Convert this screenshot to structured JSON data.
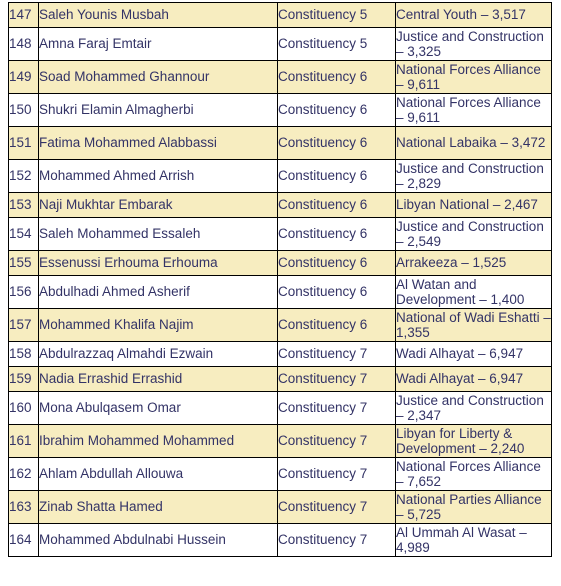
{
  "table": {
    "columns": [
      "index",
      "candidate_name",
      "constituency",
      "party_and_votes"
    ],
    "colors": {
      "shaded_row": "#f7edc0",
      "plain_row": "#ffffff",
      "text": "#333366",
      "border": "#000000"
    },
    "rows": [
      {
        "index": "147",
        "name": "Saleh Younis  Musbah",
        "constituency": "Constituency 5",
        "party": "Central Youth – 3,517",
        "shaded": true,
        "lines": 1
      },
      {
        "index": "148",
        "name": "Amna Faraj Emtair",
        "constituency": "Constituency 5",
        "party": "Justice and Construction – 3,325",
        "shaded": false,
        "lines": 2
      },
      {
        "index": "149",
        "name": "Soad Mohammed Ghannour",
        "constituency": "Constituency 6",
        "party": "National Forces Alliance – 9,611",
        "shaded": true,
        "lines": 2
      },
      {
        "index": "150",
        "name": "Shukri Elamin Almagherbi",
        "constituency": "Constituency 6",
        "party": "National Forces Alliance – 9,611",
        "shaded": false,
        "lines": 2
      },
      {
        "index": "151",
        "name": "Fatima Mohammed Alabbassi",
        "constituency": "Constituency 6",
        "party": "National Labaika – 3,472",
        "shaded": true,
        "lines": 2
      },
      {
        "index": "152",
        "name": "Mohammed Ahmed Arrish",
        "constituency": "Constituency 6",
        "party": "Justice and Construction – 2,829",
        "shaded": false,
        "lines": 2
      },
      {
        "index": "153",
        "name": "Naji Mukhtar Embarak",
        "constituency": "Constituency 6",
        "party": "Libyan National – 2,467",
        "shaded": true,
        "lines": 1
      },
      {
        "index": "154",
        "name": "Saleh Mohammed Essaleh",
        "constituency": "Constituency 6",
        "party": "Justice and Construction – 2,549",
        "shaded": false,
        "lines": 2
      },
      {
        "index": "155",
        "name": "Essenussi Erhouma Erhouma",
        "constituency": "Constituency 6",
        "party": "Arrakeeza – 1,525",
        "shaded": true,
        "lines": 1
      },
      {
        "index": "156",
        "name": "Abdulhadi Ahmed Asherif",
        "constituency": "Constituency 6",
        "party": "Al Watan and Development – 1,400",
        "shaded": false,
        "lines": 2
      },
      {
        "index": "157",
        "name": "Mohammed Khalifa Najim",
        "constituency": "Constituency 6",
        "party": "National of Wadi Eshatti – 1,355",
        "shaded": true,
        "lines": 2
      },
      {
        "index": "158",
        "name": "Abdulrazzaq Almahdi Ezwain",
        "constituency": "Constituency 7",
        "party": "Wadi Alhayat – 6,947",
        "shaded": false,
        "lines": 1
      },
      {
        "index": "159",
        "name": "Nadia Errashid Errashid",
        "constituency": "Constituency 7",
        "party": "Wadi Alhayat – 6,947",
        "shaded": true,
        "lines": 1
      },
      {
        "index": "160",
        "name": "Mona Abulqasem Omar",
        "constituency": "Constituency 7",
        "party": "Justice and Construction – 2,347",
        "shaded": false,
        "lines": 2
      },
      {
        "index": "161",
        "name": "Ibrahim Mohammed Mohammed",
        "constituency": "Constituency 7",
        "party": "Libyan for Liberty & Development – 2,240",
        "shaded": true,
        "lines": 2
      },
      {
        "index": "162",
        "name": "Ahlam Abdullah Allouwa",
        "constituency": "Constituency 7",
        "party": "National Forces Alliance – 7,652",
        "shaded": false,
        "lines": 2
      },
      {
        "index": "163",
        "name": "Zinab Shatta Hamed",
        "constituency": "Constituency 7",
        "party": "National Parties Alliance – 5,725",
        "shaded": true,
        "lines": 2
      },
      {
        "index": "164",
        "name": "Mohammed Abdulnabi  Hussein",
        "constituency": "Constituency 7",
        "party": "Al Ummah Al Wasat – 4,989",
        "shaded": false,
        "lines": 2
      }
    ]
  }
}
